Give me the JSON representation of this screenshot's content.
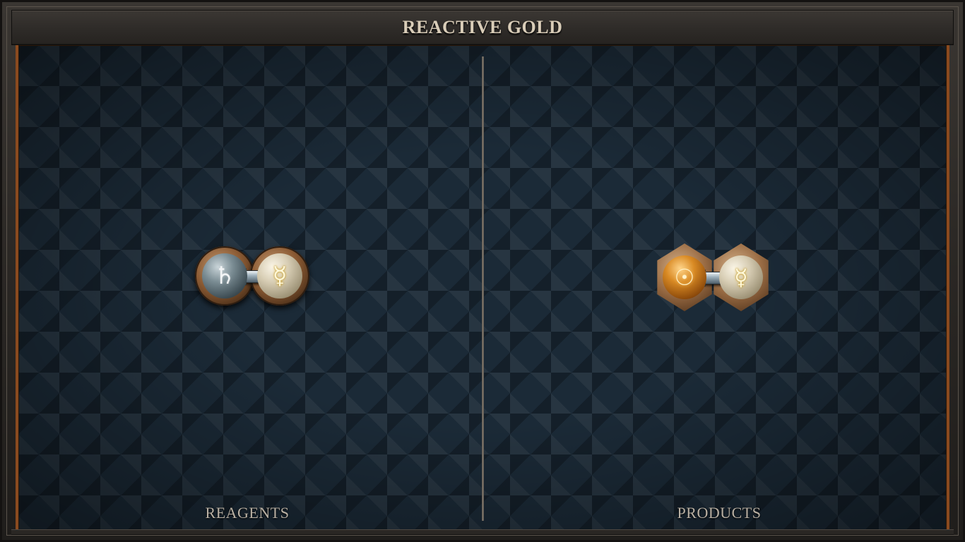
{
  "window": {
    "title": "REACTIVE GOLD"
  },
  "panels": {
    "reagents": {
      "label": "REAGENTS",
      "molecule": {
        "atoms": [
          {
            "element": "lead",
            "symbol": "♄",
            "icon": "saturn-lead-symbol-icon",
            "color": "#7a8c93"
          },
          {
            "element": "quicksilver",
            "symbol": "☿",
            "icon": "mercury-symbol-icon",
            "color": "#d8ceb5"
          }
        ],
        "bonds": 1
      }
    },
    "products": {
      "label": "PRODUCTS",
      "molecule": {
        "atoms": [
          {
            "element": "gold",
            "symbol": "☉",
            "icon": "sun-gold-symbol-icon",
            "color": "#d98a24"
          },
          {
            "element": "quicksilver",
            "symbol": "☿",
            "icon": "mercury-symbol-icon",
            "color": "#d8ceb5"
          }
        ],
        "bonds": 1
      }
    }
  },
  "colors": {
    "board": "#1b2a37",
    "frame": "#2e2b28",
    "accent_copper": "#8a4a1f",
    "title_text": "#d9cdb8",
    "label_text": "#b9b0a3"
  }
}
